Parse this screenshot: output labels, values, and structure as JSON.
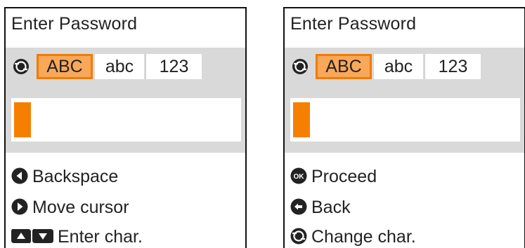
{
  "panels": [
    {
      "title": "Enter Password",
      "modes": [
        "ABC",
        "abc",
        "123"
      ],
      "active_mode": "ABC",
      "help": [
        {
          "icon": "left-arrow-icon",
          "label": "Backspace"
        },
        {
          "icon": "right-arrow-icon",
          "label": "Move cursor"
        },
        {
          "icon": "up-down-arrow-icon",
          "label": "Enter char."
        }
      ]
    },
    {
      "title": "Enter Password",
      "modes": [
        "ABC",
        "abc",
        "123"
      ],
      "active_mode": "ABC",
      "help": [
        {
          "icon": "ok-button-icon",
          "label": "Proceed"
        },
        {
          "icon": "back-button-icon",
          "label": "Back"
        },
        {
          "icon": "change-char-icon",
          "label": "Change char."
        }
      ]
    }
  ],
  "colors": {
    "accent": "#f07c00",
    "cursor": "#f77f00",
    "row_bg": "#d9d9d9",
    "border": "#111111"
  }
}
